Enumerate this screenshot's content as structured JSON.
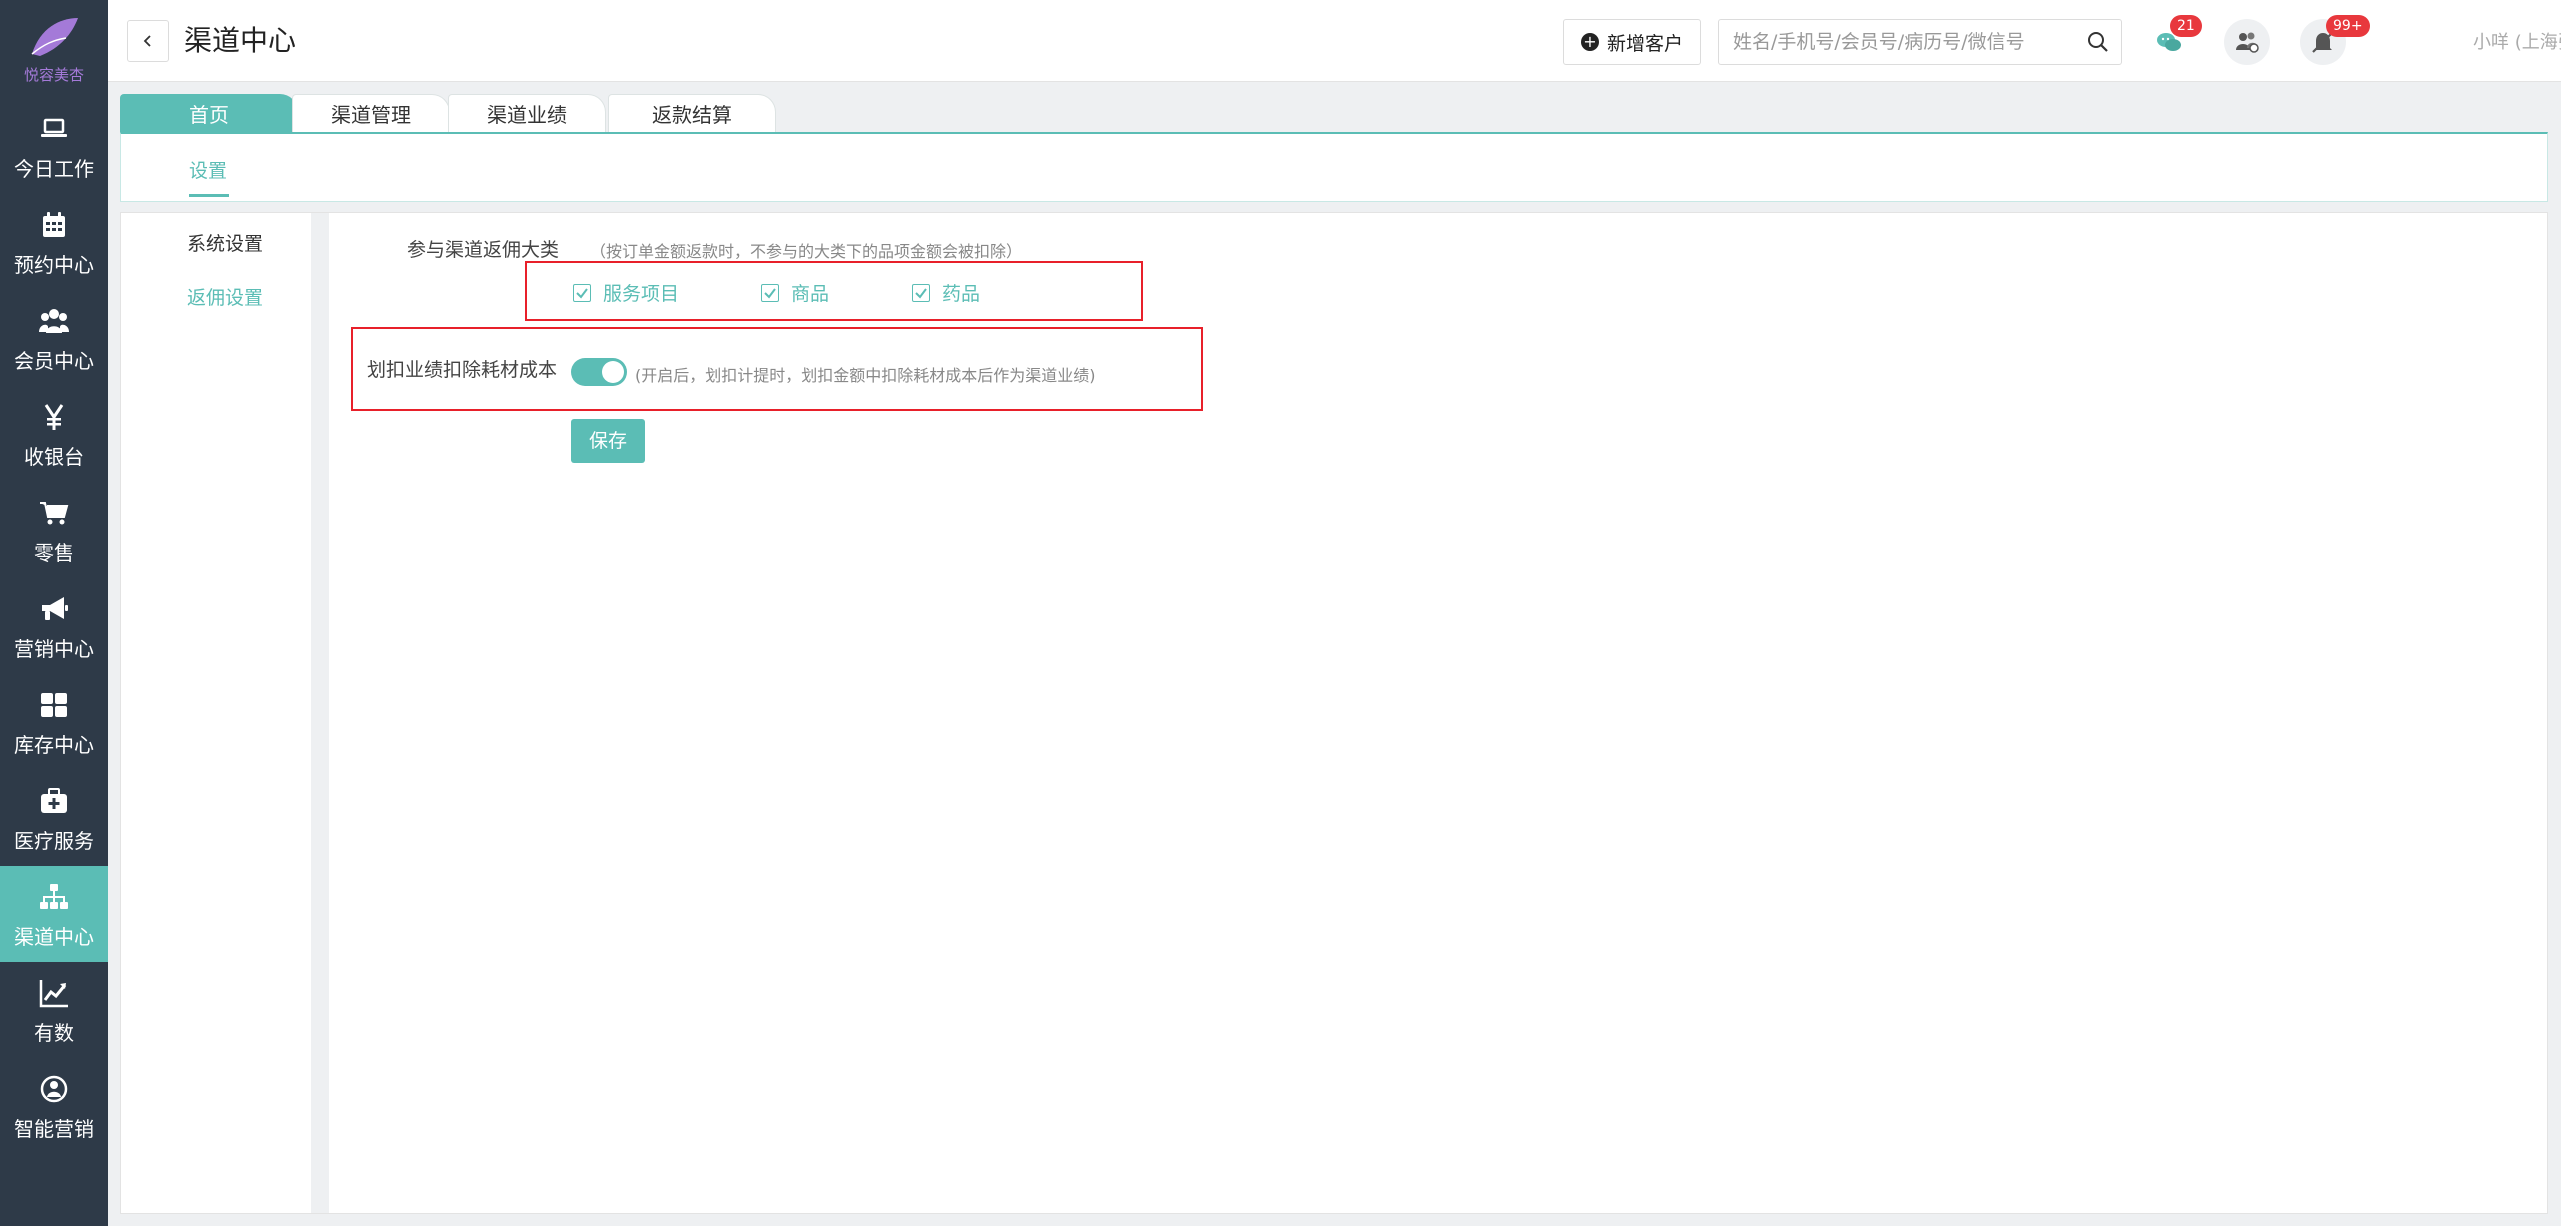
{
  "brand": {
    "logo_text": "悦容美杏"
  },
  "sidebar": {
    "items": [
      {
        "label": "今日工作",
        "icon": "laptop-icon"
      },
      {
        "label": "预约中心",
        "icon": "calendar-icon"
      },
      {
        "label": "会员中心",
        "icon": "users-icon"
      },
      {
        "label": "收银台",
        "icon": "yen-icon"
      },
      {
        "label": "零售",
        "icon": "cart-icon"
      },
      {
        "label": "营销中心",
        "icon": "megaphone-icon"
      },
      {
        "label": "库存中心",
        "icon": "grid-icon"
      },
      {
        "label": "医疗服务",
        "icon": "medkit-icon"
      },
      {
        "label": "渠道中心",
        "icon": "sitemap-icon",
        "active": true
      },
      {
        "label": "有数",
        "icon": "chart-line-icon"
      },
      {
        "label": "智能营销",
        "icon": "robot-icon"
      }
    ]
  },
  "header": {
    "title": "渠道中心",
    "add_customer_label": "新增客户",
    "search_placeholder": "姓名/手机号/会员号/病历号/微信号",
    "wechat_badge": "21",
    "notify_badge": "99+",
    "user": "小咩 (上海张江门诊)"
  },
  "tabs": [
    {
      "label": "首页",
      "active": true
    },
    {
      "label": "渠道管理"
    },
    {
      "label": "渠道业绩"
    },
    {
      "label": "返款结算"
    }
  ],
  "subnav": {
    "item": "设置"
  },
  "left_menu": [
    {
      "label": "系统设置"
    },
    {
      "label": "返佣设置",
      "active": true
    }
  ],
  "form": {
    "category_label": "参与渠道返佣大类",
    "category_hint": "（按订单金额返款时，不参与的大类下的品项金额会被扣除）",
    "categories": [
      {
        "label": "服务项目",
        "checked": true
      },
      {
        "label": "商品",
        "checked": true
      },
      {
        "label": "药品",
        "checked": true
      }
    ],
    "deduct_label": "划扣业绩扣除耗材成本",
    "deduct_enabled": true,
    "deduct_hint": "(开启后，划扣计提时，划扣金额中扣除耗材成本后作为渠道业绩)",
    "save_label": "保存"
  },
  "colors": {
    "accent": "#5bbdb5",
    "sidebar_bg": "#2e3a48",
    "highlight_red": "#e8202a",
    "badge_red": "#e8383d",
    "logo_purple": "#a47ad8"
  }
}
